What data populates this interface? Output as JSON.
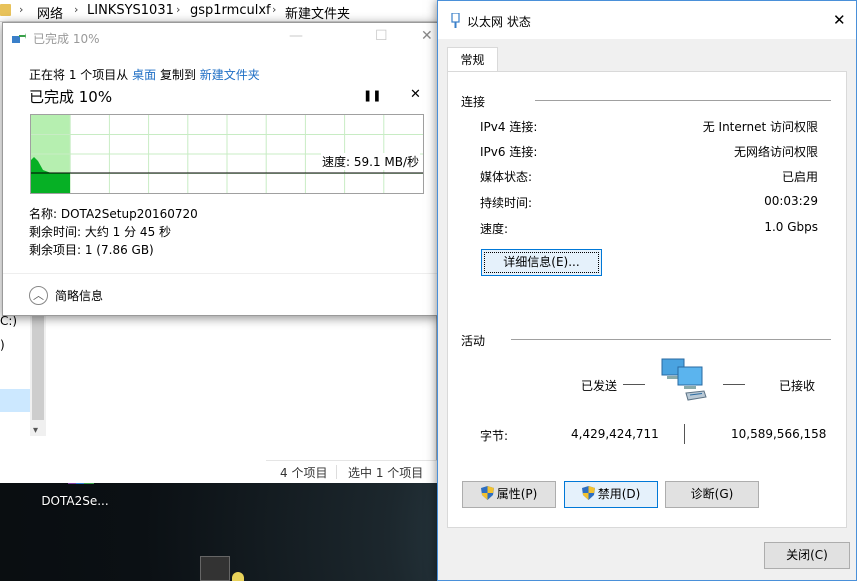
{
  "explorer": {
    "breadcrumb": [
      "网络",
      "LINKSYS1031",
      "gsp1rmculxf",
      "新建文件夹"
    ],
    "left_labels": [
      "C:)",
      ")"
    ],
    "status_items": "4 个项目",
    "status_selected": "选中 1 个项目"
  },
  "desktop": {
    "icon_label": "DOTA2Se..."
  },
  "copy_dialog": {
    "title": "已完成 10%",
    "line_prefix": "正在将 1 个项目从",
    "source": "桌面",
    "line_mid": "复制到",
    "destination": "新建文件夹",
    "percent_text": "已完成 10%",
    "progress": 0.1,
    "speed": "速度: 59.1 MB/秒",
    "name_line": "名称: DOTA2Setup20160720",
    "time_line": "剩余时间: 大约 1 分 45 秒",
    "items_line": "剩余项目: 1 (7.86 GB)",
    "details_label": "简略信息",
    "pause_icon": "pause-icon",
    "close_icon": "close-icon"
  },
  "ethernet_dialog": {
    "title": "以太网 状态",
    "tab": "常规",
    "connection_group": "连接",
    "rows": [
      {
        "key": "IPv4 连接:",
        "value": "无 Internet 访问权限"
      },
      {
        "key": "IPv6 连接:",
        "value": "无网络访问权限"
      },
      {
        "key": "媒体状态:",
        "value": "已启用"
      },
      {
        "key": "持续时间:",
        "value": "00:03:29"
      },
      {
        "key": "速度:",
        "value": "1.0 Gbps"
      }
    ],
    "details_button": "详细信息(E)...",
    "activity_group": "活动",
    "sent_label": "已发送",
    "received_label": "已接收",
    "bytes_label": "字节:",
    "bytes_sent": "4,429,424,711",
    "bytes_received": "10,589,566,158",
    "properties_button": "属性(P)",
    "disable_button": "禁用(D)",
    "diagnose_button": "诊断(G)",
    "close_button": "关闭(C)",
    "accent": "#0078d7"
  }
}
